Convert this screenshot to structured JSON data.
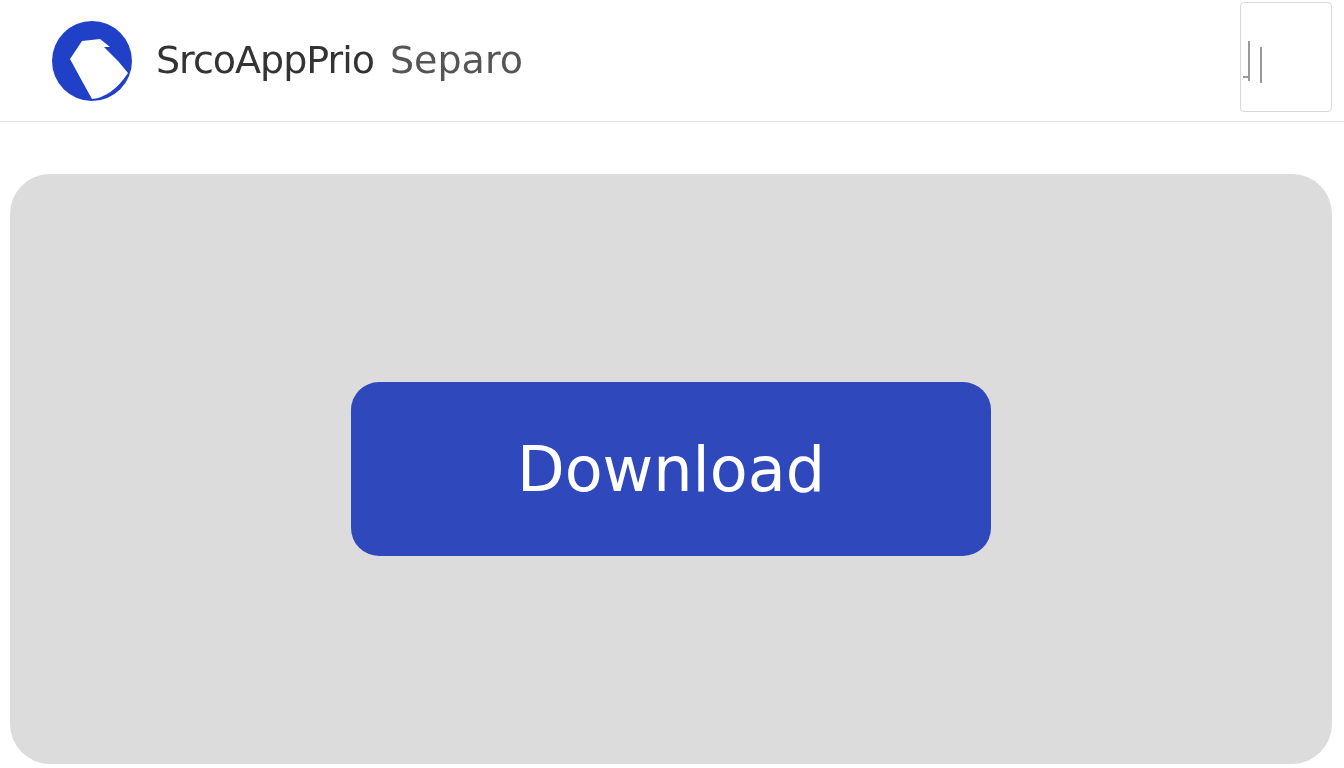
{
  "header": {
    "brand": "SrcoAppPrio",
    "subtitle": "Separo"
  },
  "main": {
    "button": "Download"
  }
}
